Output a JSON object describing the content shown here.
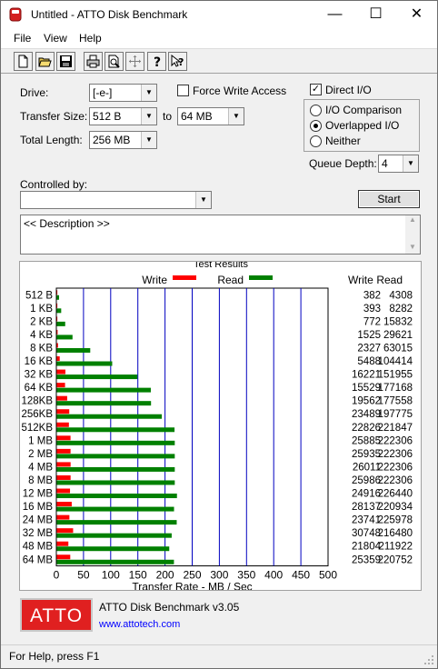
{
  "window": {
    "title": "Untitled - ATTO Disk Benchmark"
  },
  "menu": [
    "File",
    "View",
    "Help"
  ],
  "toolbar_icons": [
    "new-icon",
    "open-icon",
    "save-icon",
    "print-icon",
    "print-preview-icon",
    "move-icon",
    "help-icon",
    "context-help-icon"
  ],
  "form": {
    "drive_label": "Drive:",
    "drive_value": "[-e-]",
    "force_write_label": "Force Write Access",
    "direct_io_label": "Direct I/O",
    "transfer_size_label": "Transfer Size:",
    "transfer_from": "512 B",
    "to_label": "to",
    "transfer_to": "64 MB",
    "total_length_label": "Total Length:",
    "total_length": "256 MB",
    "io_comparison_label": "I/O Comparison",
    "overlapped_label": "Overlapped I/O",
    "neither_label": "Neither",
    "queue_depth_label": "Queue Depth:",
    "queue_depth": "4",
    "controlled_by_label": "Controlled by:",
    "controlled_by_value": "",
    "start_label": "Start",
    "description": "<< Description >>"
  },
  "results": {
    "title": "Test Results",
    "write_legend": "Write",
    "read_legend": "Read",
    "write_header": "Write",
    "read_header": "Read",
    "xlabel": "Transfer Rate - MB / Sec"
  },
  "colors": {
    "write": "#ff0000",
    "read": "#008000",
    "grid": "#0000c0",
    "logo": "#e02020"
  },
  "chart_data": {
    "type": "bar",
    "categories": [
      "512 B",
      "1 KB",
      "2 KB",
      "4 KB",
      "8 KB",
      "16 KB",
      "32 KB",
      "64 KB",
      "128KB",
      "256KB",
      "512KB",
      "1 MB",
      "2 MB",
      "4 MB",
      "8 MB",
      "12 MB",
      "16 MB",
      "24 MB",
      "32 MB",
      "48 MB",
      "64 MB"
    ],
    "series": [
      {
        "name": "Write",
        "values": [
          382,
          393,
          772,
          1525,
          2327,
          5488,
          16221,
          15529,
          19562,
          23489,
          22826,
          25885,
          25935,
          26011,
          25986,
          24916,
          28137,
          23741,
          30748,
          21804,
          25359
        ]
      },
      {
        "name": "Read",
        "values": [
          4308,
          8282,
          15832,
          29621,
          63015,
          104414,
          151955,
          177168,
          177558,
          197775,
          221847,
          222306,
          222306,
          222306,
          222306,
          226440,
          220934,
          225978,
          216480,
          211922,
          220752
        ]
      }
    ],
    "xlabel": "Transfer Rate - MB / Sec",
    "xticks": [
      "0",
      "50",
      "100",
      "150",
      "200",
      "250",
      "300",
      "350",
      "400",
      "450",
      "500"
    ],
    "xlim": [
      0,
      500
    ],
    "grid": true,
    "legend": "top-center"
  },
  "footer": {
    "logo_text": "ATTO",
    "product": "ATTO Disk Benchmark v3.05",
    "url": "www.attotech.com"
  },
  "status": "For Help, press F1"
}
